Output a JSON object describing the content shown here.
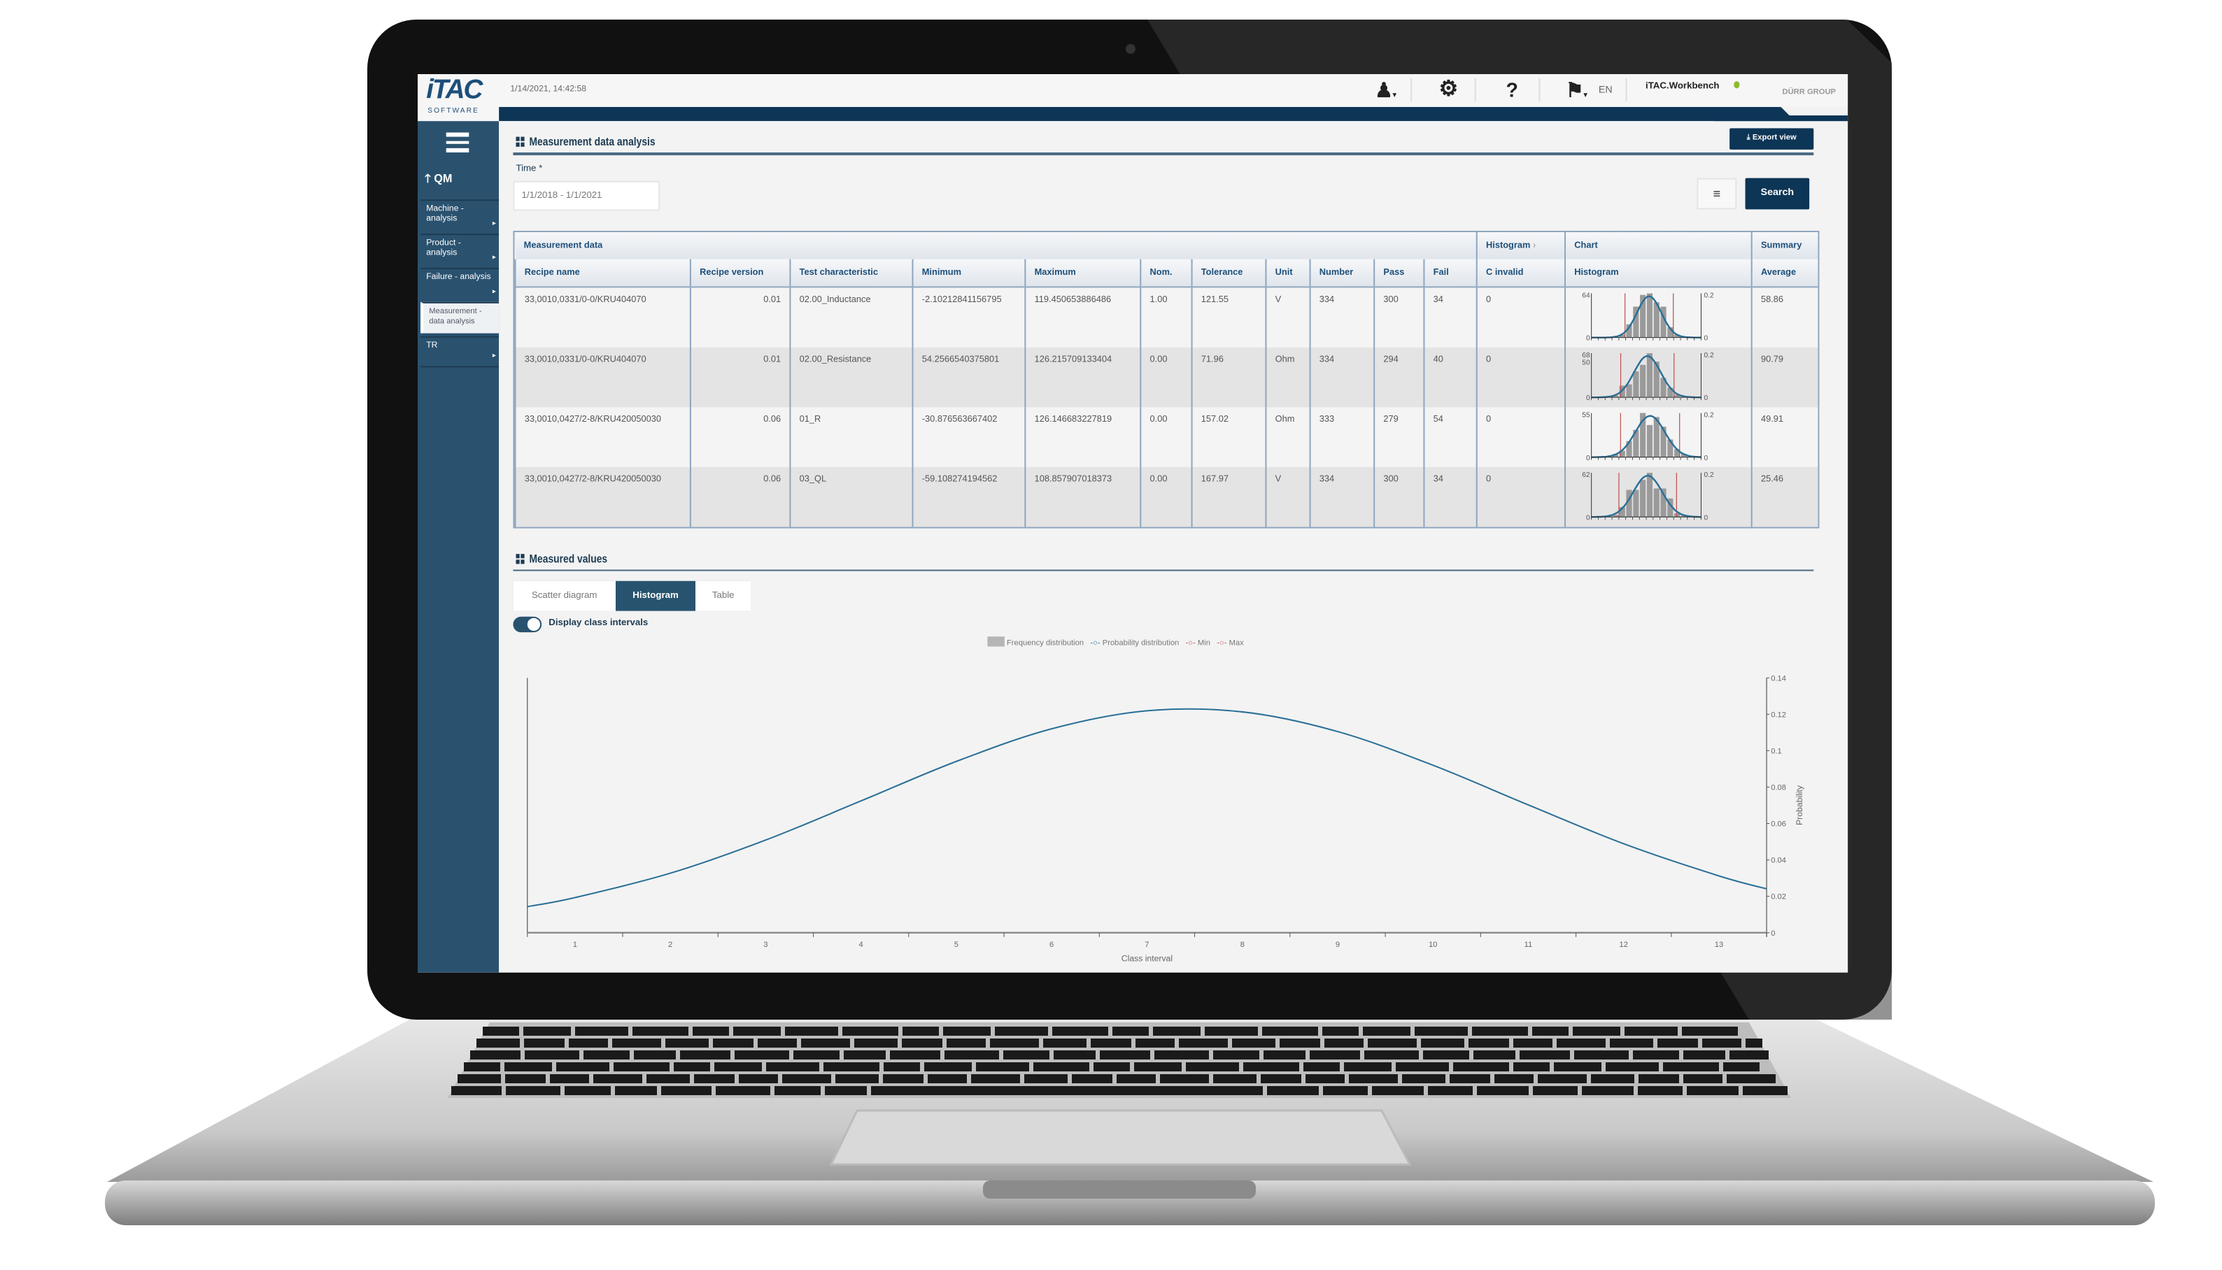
{
  "header": {
    "logo_text": "iTAC",
    "logo_sub": "SOFTWARE",
    "datetime": "1/14/2021, 14:42:58",
    "language": "EN",
    "app_name": "iTAC.Workbench",
    "brand": "DÜRR GROUP",
    "icons": [
      "user-icon",
      "gear-icon",
      "help-icon",
      "flag-icon"
    ]
  },
  "sidebar": {
    "menu_icon": "hamburger-icon",
    "section": "QM",
    "items": [
      {
        "label": "Machine - analysis",
        "selected": false
      },
      {
        "label": "Product - analysis",
        "selected": false
      },
      {
        "label": "Failure - analysis",
        "selected": false
      },
      {
        "label": "Measurement - data analysis",
        "selected": true
      },
      {
        "label": "TR",
        "selected": false
      }
    ]
  },
  "main": {
    "title": "Measurement data analysis",
    "export_label": "Export view",
    "time_label": "Time *",
    "time_value": "1/1/2018 - 1/1/2021",
    "search_label": "Search"
  },
  "table": {
    "group_headers": [
      "Measurement data",
      "Histogram",
      "Chart",
      "Summary"
    ],
    "columns": [
      "Recipe name",
      "Recipe version",
      "Test characteristic",
      "Minimum",
      "Maximum",
      "Nom.",
      "Tolerance",
      "Unit",
      "Number",
      "Pass",
      "Fail",
      "C invalid",
      "Histogram",
      "Average"
    ],
    "rows": [
      {
        "cells": [
          "33,0010,0331/0-0/KRU404070",
          "0.01",
          "02.00_Inductance",
          "-2.10212841156795",
          "119.450653886486",
          "1.00",
          "121.55",
          "V",
          "334",
          "300",
          "34",
          "0"
        ],
        "average": "58.86",
        "hist_ymax": "64",
        "hist_ymid": "",
        "hist_bins": [
          0,
          0,
          0,
          1,
          4,
          18,
          42,
          58,
          60,
          48,
          42,
          14,
          4,
          1,
          0,
          0
        ]
      },
      {
        "cells": [
          "33,0010,0331/0-0/KRU404070",
          "0.01",
          "02.00_Resistance",
          "54.2566540375801",
          "126.215709133404",
          "0.00",
          "71.96",
          "Ohm",
          "334",
          "294",
          "40",
          "0"
        ],
        "average": "90.79",
        "hist_ymax": "68",
        "hist_ymid": "50",
        "hist_bins": [
          0,
          0,
          1,
          3,
          18,
          20,
          40,
          50,
          68,
          55,
          30,
          15,
          4,
          1,
          0,
          0
        ]
      },
      {
        "cells": [
          "33,0010,0427/2-8/KRU420050030",
          "0.06",
          "01_R",
          "-30.876563667402",
          "126.146683227819",
          "0.00",
          "157.02",
          "Ohm",
          "333",
          "279",
          "54",
          "0"
        ],
        "average": "49.91",
        "hist_ymax": "55",
        "hist_ymid": "",
        "hist_bins": [
          0,
          0,
          1,
          4,
          8,
          20,
          34,
          55,
          40,
          50,
          38,
          22,
          10,
          4,
          1,
          0
        ]
      },
      {
        "cells": [
          "33,0010,0427/2-8/KRU420050030",
          "0.06",
          "03_QL",
          "-59.108274194562",
          "108.857907018373",
          "0.00",
          "167.97",
          "V",
          "334",
          "300",
          "34",
          "0"
        ],
        "average": "25.46",
        "hist_ymax": "62",
        "hist_ymid": "",
        "hist_bins": [
          0,
          0,
          1,
          3,
          14,
          38,
          38,
          52,
          62,
          40,
          40,
          26,
          5,
          2,
          0,
          0
        ]
      }
    ],
    "hist_right_max": "0.2",
    "hist_zero": "0"
  },
  "measured": {
    "title": "Measured values",
    "tabs": [
      {
        "label": "Scatter diagram",
        "active": false
      },
      {
        "label": "Histogram",
        "active": true
      },
      {
        "label": "Table",
        "active": false
      }
    ],
    "toggle_label": "Display class intervals",
    "toggle_on": true
  },
  "chart_data": {
    "type": "line",
    "legend": [
      "Frequency distribution",
      "Probability distribution",
      "Min",
      "Max"
    ],
    "legend_placement": "top",
    "colors": {
      "frequency": "#b5b5b5",
      "probability": "#2a6f97",
      "min": "#c0504d",
      "max": "#c0504d"
    },
    "xlabel": "Class interval",
    "ylabel": "Probability",
    "x_ticks": [
      "1",
      "2",
      "3",
      "4",
      "5",
      "6",
      "7",
      "8",
      "9",
      "10",
      "11",
      "12",
      "13"
    ],
    "y_ticks": [
      "0",
      "0.02",
      "0.04",
      "0.06",
      "0.08",
      "0.1",
      "0.12",
      "0.14"
    ],
    "xlim": [
      0.5,
      13.5
    ],
    "ylim": [
      0,
      0.14
    ],
    "y_axis_side": "right",
    "grid": false,
    "series": [
      {
        "name": "Probability distribution",
        "x": [
          0.5,
          1,
          2,
          3,
          4,
          5,
          6,
          7,
          8,
          9,
          10,
          11,
          12,
          13,
          13.5
        ],
        "y": [
          0.0143,
          0.0193,
          0.0327,
          0.0509,
          0.0724,
          0.0941,
          0.112,
          0.1219,
          0.1213,
          0.1105,
          0.092,
          0.0702,
          0.0489,
          0.0312,
          0.0241
        ]
      }
    ]
  }
}
